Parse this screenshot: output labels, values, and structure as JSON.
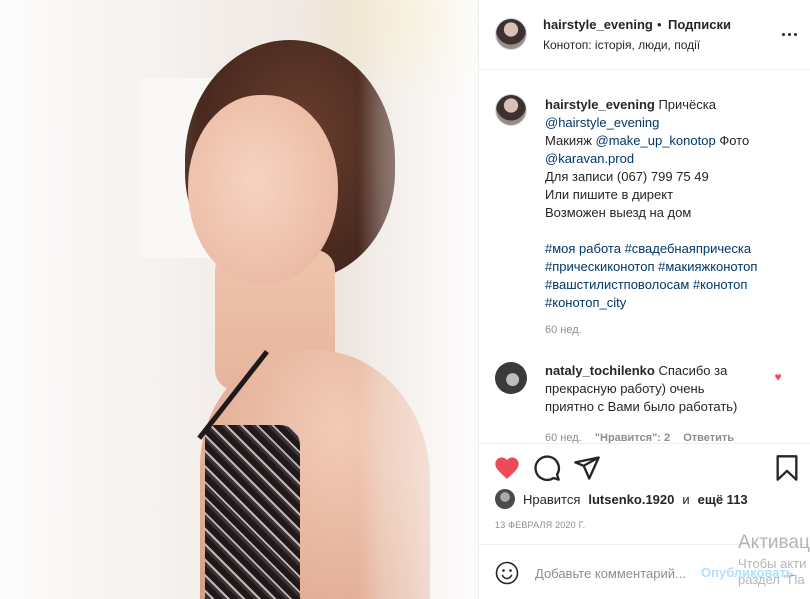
{
  "post": {
    "username": "hairstyle_evening",
    "separator": "•",
    "follow_label": "Подписки",
    "location": "Конотоп: історія, люди, події"
  },
  "caption": {
    "lines": [
      [
        "hairstyle_evening",
        " Причёска"
      ],
      [
        "@hairstyle_evening"
      ],
      [
        "Макияж ",
        "@make_up_konotop",
        " Фото"
      ],
      [
        "@karavan.prod"
      ],
      [
        "Для записи (067) 799 75 49"
      ],
      [
        "Или пишите в директ"
      ],
      [
        "Возможен выезд на дом"
      ],
      [
        ""
      ],
      [
        "#моя работа",
        " ",
        "#свадебнаяприческа"
      ],
      [
        "#прическиконотоп",
        " ",
        "#макияжконотоп"
      ],
      [
        "#вашстилистповолосам",
        " ",
        "#конотоп"
      ],
      [
        "#конотоп_city"
      ]
    ],
    "author": "hairstyle_evening",
    "text_1": "Причёска",
    "mention_1": "@hairstyle_evening",
    "text_2": "Макияж",
    "mention_2": "@make_up_konotop",
    "text_3": "Фото",
    "mention_3": "@karavan.prod",
    "text_4": "Для записи (067) 799 75 49",
    "text_5": "Или пишите в директ",
    "text_6": "Возможен выезд на дом",
    "tags": [
      "#моя работа",
      "#свадебнаяприческа",
      "#прическиконотоп",
      "#макияжконотоп",
      "#вашстилистповолосам",
      "#конотоп",
      "#конотоп_city"
    ],
    "time": "60 нед."
  },
  "comment": {
    "author": "nataly_tochilenko",
    "text_1": "Спасибо за",
    "text_2": "прекрасную работу) очень",
    "text_3": "приятно с Вами было работать)",
    "time": "60 нед.",
    "likes": "\"Нравится\": 2",
    "reply": "Ответить"
  },
  "actions": {
    "like_icon": "heart-filled-icon",
    "comment_icon": "comment-icon",
    "share_icon": "share-icon",
    "save_icon": "bookmark-icon",
    "like_color": "#ed4956"
  },
  "likes": {
    "prefix": "Нравится",
    "user": "lutsenko.1920",
    "and": "и",
    "others": "ещё 113"
  },
  "date": "13 ФЕВРАЛЯ 2020 Г.",
  "add_comment": {
    "placeholder": "Добавьте комментарий...",
    "post_label": "Опубликовать"
  },
  "watermark": {
    "title": "Активац",
    "line": "Чтобы акти",
    "line2": "раздел \"Па"
  }
}
